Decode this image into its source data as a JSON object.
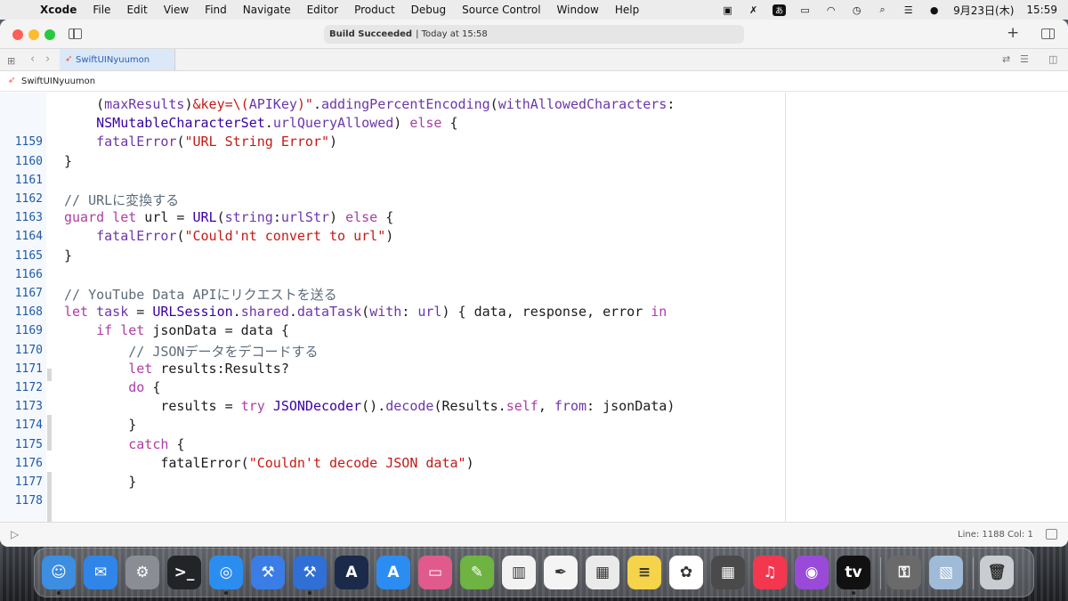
{
  "menubar": {
    "app_name": "Xcode",
    "items": [
      "File",
      "Edit",
      "View",
      "Find",
      "Navigate",
      "Editor",
      "Product",
      "Debug",
      "Source Control",
      "Window",
      "Help"
    ],
    "input_method": "あ",
    "date": "9月23日(木)",
    "time": "15:59"
  },
  "titlebar": {
    "activity_status": "Build Succeeded",
    "activity_time": "| Today at 15:58",
    "add_label": "+"
  },
  "tabbar": {
    "active_tab": "SwiftUINyuumon"
  },
  "pathbar": {
    "file": "SwiftUINyuumon"
  },
  "editor": {
    "gutter": [
      {
        "n": "",
        "top": 0
      },
      {
        "n": "",
        "top": 0
      },
      {
        "n": "1159",
        "top": 0
      },
      {
        "n": "1160",
        "top": 0
      },
      {
        "n": "1161",
        "top": 0
      },
      {
        "n": "1162",
        "top": 0
      },
      {
        "n": "1163",
        "top": 0
      },
      {
        "n": "1164",
        "top": 0
      },
      {
        "n": "1165",
        "top": 0
      },
      {
        "n": "1166",
        "top": 0
      },
      {
        "n": "1167",
        "top": 0
      },
      {
        "n": "1168",
        "top": 0
      },
      {
        "n": "1169",
        "top": 0
      },
      {
        "n": "1170",
        "top": 0
      },
      {
        "n": "1171",
        "top": 0
      },
      {
        "n": "1172",
        "top": 0
      },
      {
        "n": "1173",
        "top": 0
      },
      {
        "n": "1174",
        "top": 0
      },
      {
        "n": "1175",
        "top": 0
      },
      {
        "n": "1176",
        "top": 0
      },
      {
        "n": "1177",
        "top": 0
      },
      {
        "n": "1178",
        "top": 0
      }
    ],
    "lines": [
      [
        [
          "pl",
          "    ("
        ],
        [
          "fn",
          "maxResults"
        ],
        [
          "pl",
          ")"
        ],
        [
          "str",
          "&key=\\("
        ],
        [
          "fn",
          "APIKey"
        ],
        [
          "str",
          ")\""
        ],
        [
          "pl",
          "."
        ],
        [
          "fn",
          "addingPercentEncoding"
        ],
        [
          "pl",
          "("
        ],
        [
          "fn",
          "withAllowedCharacters"
        ],
        [
          "pl",
          ":"
        ]
      ],
      [
        [
          "ty",
          "    NSMutableCharacterSet"
        ],
        [
          "pl",
          "."
        ],
        [
          "fn",
          "urlQueryAllowed"
        ],
        [
          "pl",
          ") "
        ],
        [
          "kw",
          "else"
        ],
        [
          "pl",
          " {"
        ]
      ],
      [
        [
          "pl",
          "    "
        ],
        [
          "fn",
          "fatalError"
        ],
        [
          "pl",
          "("
        ],
        [
          "str",
          "\"URL String Error\""
        ],
        [
          "pl",
          ")"
        ]
      ],
      [
        [
          "pl",
          "}"
        ]
      ],
      [
        [
          "pl",
          ""
        ]
      ],
      [
        [
          "cm",
          "// URLに変換する"
        ]
      ],
      [
        [
          "kw",
          "guard let"
        ],
        [
          "pl",
          " url = "
        ],
        [
          "ty",
          "URL"
        ],
        [
          "pl",
          "("
        ],
        [
          "fn",
          "string"
        ],
        [
          "pl",
          ":"
        ],
        [
          "fn",
          "urlStr"
        ],
        [
          "pl",
          ") "
        ],
        [
          "kw",
          "else"
        ],
        [
          "pl",
          " {"
        ]
      ],
      [
        [
          "pl",
          "    "
        ],
        [
          "fn",
          "fatalError"
        ],
        [
          "pl",
          "("
        ],
        [
          "str",
          "\"Could'nt convert to url\""
        ],
        [
          "pl",
          ")"
        ]
      ],
      [
        [
          "pl",
          "}"
        ]
      ],
      [
        [
          "pl",
          ""
        ]
      ],
      [
        [
          "cm",
          "// YouTube Data APIにリクエストを送る"
        ]
      ],
      [
        [
          "kw",
          "let"
        ],
        [
          "pl",
          " "
        ],
        [
          "fn",
          "task"
        ],
        [
          "pl",
          " = "
        ],
        [
          "ty",
          "URLSession"
        ],
        [
          "pl",
          "."
        ],
        [
          "fn",
          "shared"
        ],
        [
          "pl",
          "."
        ],
        [
          "fn",
          "dataTask"
        ],
        [
          "pl",
          "("
        ],
        [
          "fn",
          "with"
        ],
        [
          "pl",
          ": "
        ],
        [
          "fn",
          "url"
        ],
        [
          "pl",
          ") { data, response, error "
        ],
        [
          "kw",
          "in"
        ]
      ],
      [
        [
          "pl",
          "    "
        ],
        [
          "kw",
          "if let"
        ],
        [
          "pl",
          " jsonData = data {"
        ]
      ],
      [
        [
          "cm",
          "        // JSONデータをデコードする"
        ]
      ],
      [
        [
          "pl",
          "        "
        ],
        [
          "kw",
          "let"
        ],
        [
          "pl",
          " results:Results?"
        ]
      ],
      [
        [
          "pl",
          "        "
        ],
        [
          "kw",
          "do"
        ],
        [
          "pl",
          " {"
        ]
      ],
      [
        [
          "pl",
          "            results = "
        ],
        [
          "kw",
          "try"
        ],
        [
          "pl",
          " "
        ],
        [
          "ty",
          "JSONDecoder"
        ],
        [
          "pl",
          "()."
        ],
        [
          "fn",
          "decode"
        ],
        [
          "pl",
          "(Results."
        ],
        [
          "kw",
          "self"
        ],
        [
          "pl",
          ", "
        ],
        [
          "fn",
          "from"
        ],
        [
          "pl",
          ": jsonData)"
        ]
      ],
      [
        [
          "pl",
          "        }"
        ]
      ],
      [
        [
          "pl",
          "        "
        ],
        [
          "kw",
          "catch"
        ],
        [
          "pl",
          " {"
        ]
      ],
      [
        [
          "pl",
          "            fatalError("
        ],
        [
          "str",
          "\"Couldn't decode JSON data\""
        ],
        [
          "pl",
          ")"
        ]
      ],
      [
        [
          "pl",
          "        }"
        ]
      ],
      [
        [
          "pl",
          ""
        ]
      ]
    ]
  },
  "statusbar": {
    "line_col": "Line: 1188  Col: 1"
  },
  "dock": {
    "apps": [
      {
        "name": "finder",
        "color": "#3d8de0",
        "glyph": "☺"
      },
      {
        "name": "mail",
        "color": "#2f86e8",
        "glyph": "✉"
      },
      {
        "name": "system-preferences",
        "color": "#8a8d93",
        "glyph": "⚙"
      },
      {
        "name": "terminal",
        "color": "#222428",
        "glyph": ">_"
      },
      {
        "name": "safari",
        "color": "#2c8df0",
        "glyph": "◎"
      },
      {
        "name": "xcode-beta",
        "color": "#3b7de6",
        "glyph": "⚒"
      },
      {
        "name": "xcode",
        "color": "#2f6fd6",
        "glyph": "⚒"
      },
      {
        "name": "instruments",
        "color": "#1b2a4a",
        "glyph": "A"
      },
      {
        "name": "app-store",
        "color": "#2b8cf2",
        "glyph": "A"
      },
      {
        "name": "simulator",
        "color": "#e05a8c",
        "glyph": "▭"
      },
      {
        "name": "numbers-editor",
        "color": "#6fb342",
        "glyph": "✎"
      },
      {
        "name": "numbers",
        "color": "#f2f2f2",
        "glyph": "▥"
      },
      {
        "name": "pages",
        "color": "#f4f4f4",
        "glyph": "✒"
      },
      {
        "name": "keynote",
        "color": "#eaeaea",
        "glyph": "▦"
      },
      {
        "name": "notes",
        "color": "#f5d34a",
        "glyph": "≡"
      },
      {
        "name": "photos",
        "color": "#ffffff",
        "glyph": "✿"
      },
      {
        "name": "calculator",
        "color": "#4a4a4a",
        "glyph": "▦"
      },
      {
        "name": "music",
        "color": "#f3374f",
        "glyph": "♫"
      },
      {
        "name": "podcasts",
        "color": "#9a4ad9",
        "glyph": "◉"
      },
      {
        "name": "apple-tv",
        "color": "#111111",
        "glyph": "tv"
      },
      {
        "name": "keychain",
        "color": "#6a6a6a",
        "glyph": "⚿"
      },
      {
        "name": "preview",
        "color": "#9fbbd8",
        "glyph": "▧"
      },
      {
        "name": "trash",
        "color": "#c9ccd0",
        "glyph": "🗑"
      }
    ]
  }
}
